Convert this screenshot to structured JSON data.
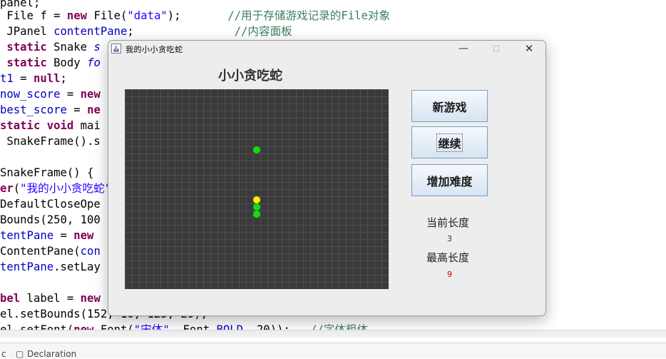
{
  "editor": {
    "lines": [
      {
        "t": "panel;"
      },
      {
        "t": " File f = new File(\"data\");      //用于存储游戏记录的File对象"
      },
      {
        "t": " JPanel contentPane;               //内容面板"
      },
      {
        "t": " static Snake s"
      },
      {
        "t": " static Body fo"
      },
      {
        "t": "t1 = null;"
      },
      {
        "t": "now_score = new"
      },
      {
        "t": "best_score = ne"
      },
      {
        "t": "static void mai"
      },
      {
        "t": " SnakeFrame().s"
      },
      {
        "t": ""
      },
      {
        "t": "SnakeFrame() {"
      },
      {
        "t": "er(\"我的小小贪吃蛇\""
      },
      {
        "t": "DefaultCloseOpe"
      },
      {
        "t": "Bounds(250, 100"
      },
      {
        "t": "tentPane = new"
      },
      {
        "t": "ContentPane(con"
      },
      {
        "t": "tentPane.setLay"
      },
      {
        "t": ""
      },
      {
        "t": "bel label = new"
      },
      {
        "t": "el.setBounds(152, 10, 125, 29);"
      },
      {
        "t": "el.setFont(new Font(\"宋体\", Font.BOLD, 20));   //字体粗体"
      }
    ],
    "bottom_tabs": [
      "c",
      "Declaration"
    ]
  },
  "window": {
    "title": "我的小小贪吃蛇",
    "minimize_glyph": "—",
    "maximize_glyph": "☐",
    "close_glyph": "✕"
  },
  "game": {
    "heading": "小小贪吃蛇",
    "buttons": {
      "new_game": "新游戏",
      "continue": "继续",
      "harder": "增加难度"
    },
    "current_length_label": "当前长度",
    "current_length": "3",
    "best_length_label": "最高长度",
    "best_length": "9",
    "colors": {
      "board": "#3a3a3a",
      "snake_head": "#ffee00",
      "snake_body": "#11dd11",
      "food": "#11dd11",
      "best_length_value": "#d00000"
    }
  }
}
